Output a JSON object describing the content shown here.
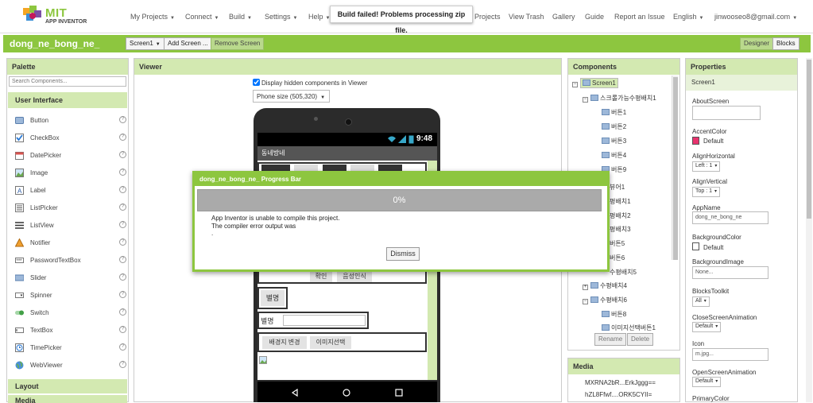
{
  "top_nav": {
    "logo_title": "MIT",
    "logo_subtitle": "APP INVENTOR",
    "items": [
      "My Projects",
      "Connect",
      "Build",
      "Settings",
      "Help",
      "Projects",
      "View Trash",
      "Gallery",
      "Guide",
      "Report an Issue",
      "English"
    ],
    "user_email": "jinwooseo8@gmail.com",
    "toast": "Build failed! Problems processing zip file."
  },
  "project_bar": {
    "title": "dong_ne_bong_ne_",
    "screen_select": "Screen1",
    "add_screen": "Add Screen ...",
    "remove_screen": "Remove Screen",
    "designer": "Designer",
    "blocks": "Blocks"
  },
  "palette": {
    "title": "Palette",
    "search_placeholder": "Search Components...",
    "category": "User Interface",
    "items": [
      "Button",
      "CheckBox",
      "DatePicker",
      "Image",
      "Label",
      "ListPicker",
      "ListView",
      "Notifier",
      "PasswordTextBox",
      "Slider",
      "Spinner",
      "Switch",
      "TextBox",
      "TimePicker",
      "WebViewer"
    ],
    "layout": "Layout",
    "media": "Media"
  },
  "viewer": {
    "title": "Viewer",
    "hidden_label": "Display hidden components in Viewer",
    "hidden_checked": true,
    "phone_size": "Phone size (505,320)",
    "status_time": "9:48",
    "app_title": "동네방네",
    "btn_confirm": "확인",
    "btn_voice": "음성인식",
    "nickname_label": "별명",
    "nickname_field_label": "별명",
    "btn_bg_change": "배경지 변경",
    "btn_image_select": "이미지선택"
  },
  "components": {
    "title": "Components",
    "tree": [
      {
        "label": "Screen1",
        "level": 0,
        "expand": "−"
      },
      {
        "label": "스크롤가능수평배치1",
        "level": 1,
        "expand": "−"
      },
      {
        "label": "버튼1",
        "level": 2
      },
      {
        "label": "버튼2",
        "level": 2
      },
      {
        "label": "버튼3",
        "level": 2
      },
      {
        "label": "버튼4",
        "level": 2
      },
      {
        "label": "버튼9",
        "level": 2
      },
      {
        "label": "뷰어1",
        "level": 1
      },
      {
        "label": "평배치1",
        "level": 1
      },
      {
        "label": "평배치2",
        "level": 1
      },
      {
        "label": "평배치3",
        "level": 1
      },
      {
        "label": "버튼5",
        "level": 2
      },
      {
        "label": "버튼6",
        "level": 2
      },
      {
        "label": "수평배치5",
        "level": 1
      },
      {
        "label": "수평배치4",
        "level": 1,
        "expand": "+"
      },
      {
        "label": "수평배치6",
        "level": 1,
        "expand": "−"
      },
      {
        "label": "버튼8",
        "level": 2
      },
      {
        "label": "이미지선택버튼1",
        "level": 2
      }
    ],
    "rename": "Rename",
    "delete": "Delete",
    "media_title": "Media",
    "media_items": [
      "MXRNA2bR...ErkJggg==",
      "hZL8Ffwf....ORK5CYII="
    ]
  },
  "properties": {
    "title": "Properties",
    "component": "Screen1",
    "about_screen": "AboutScreen",
    "accent_color": "AccentColor",
    "accent_value": "Default",
    "accent_swatch": "#e8326e",
    "align_h": "AlignHorizontal",
    "align_h_value": "Left : 1",
    "align_v": "AlignVertical",
    "align_v_value": "Top : 1",
    "app_name": "AppName",
    "app_name_value": "dong_ne_bong_ne",
    "bg_color": "BackgroundColor",
    "bg_color_value": "Default",
    "bg_image": "BackgroundImage",
    "bg_image_value": "None...",
    "blocks_toolkit": "BlocksToolkit",
    "blocks_toolkit_value": "All",
    "close_anim": "CloseScreenAnimation",
    "close_anim_value": "Default",
    "icon": "Icon",
    "icon_value": "m.jpg...",
    "open_anim": "OpenScreenAnimation",
    "open_anim_value": "Default",
    "primary_color": "PrimaryColor"
  },
  "dialog": {
    "title": "dong_ne_bong_ne_ Progress Bar",
    "progress": "0%",
    "message_line1": "App Inventor is unable to compile this project.",
    "message_line2": "The compiler error output was",
    "message_line3": ".",
    "dismiss": "Dismiss"
  }
}
